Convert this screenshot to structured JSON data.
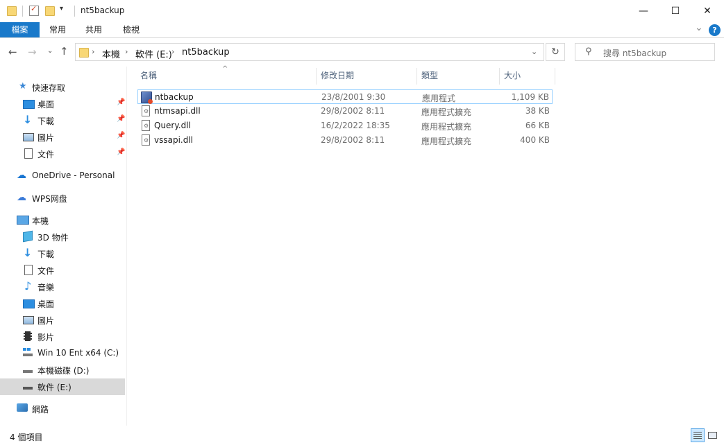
{
  "window": {
    "title": "nt5backup",
    "minimize_glyph": "—",
    "maximize_glyph": "☐",
    "close_glyph": "✕"
  },
  "ribbon": {
    "tabs": [
      "檔案",
      "常用",
      "共用",
      "檢視"
    ],
    "expand_glyph": "⌄",
    "help_glyph": "?"
  },
  "address": {
    "breadcrumb": [
      "本機",
      "軟件 (E:)",
      "nt5backup"
    ],
    "search_placeholder": "搜尋 nt5backup"
  },
  "sidebar": {
    "quick_access": {
      "label": "快速存取",
      "items": [
        {
          "label": "桌面",
          "icon": "desktop-icon"
        },
        {
          "label": "下載",
          "icon": "download-icon"
        },
        {
          "label": "圖片",
          "icon": "pictures-icon"
        },
        {
          "label": "文件",
          "icon": "documents-icon"
        }
      ]
    },
    "onedrive": "OneDrive - Personal",
    "wps": "WPS网盘",
    "this_pc": {
      "label": "本機",
      "items": [
        {
          "label": "3D 物件",
          "icon": "3d-objects-icon"
        },
        {
          "label": "下載",
          "icon": "download-icon"
        },
        {
          "label": "文件",
          "icon": "documents-icon"
        },
        {
          "label": "音樂",
          "icon": "music-icon"
        },
        {
          "label": "桌面",
          "icon": "desktop-icon"
        },
        {
          "label": "圖片",
          "icon": "pictures-icon"
        },
        {
          "label": "影片",
          "icon": "videos-icon"
        },
        {
          "label": "Win 10 Ent x64 (C:)",
          "icon": "windows-drive-icon"
        },
        {
          "label": "本機磁碟 (D:)",
          "icon": "drive-icon"
        },
        {
          "label": "軟件 (E:)",
          "icon": "drive-icon"
        }
      ]
    },
    "network": "網路"
  },
  "columns": {
    "name": "名稱",
    "date": "修改日期",
    "type": "類型",
    "size": "大小"
  },
  "files": [
    {
      "name": "ntbackup",
      "date": "23/8/2001 9:30",
      "type": "應用程式",
      "size": "1,109 KB",
      "icon": "app-icon"
    },
    {
      "name": "ntmsapi.dll",
      "date": "29/8/2002 8:11",
      "type": "應用程式擴充",
      "size": "38 KB",
      "icon": "dll-file-icon"
    },
    {
      "name": "Query.dll",
      "date": "16/2/2022 18:35",
      "type": "應用程式擴充",
      "size": "66 KB",
      "icon": "dll-file-icon"
    },
    {
      "name": "vssapi.dll",
      "date": "29/8/2002 8:11",
      "type": "應用程式擴充",
      "size": "400 KB",
      "icon": "dll-file-icon"
    }
  ],
  "status": {
    "item_count": "4 個項目"
  },
  "colors": {
    "accent": "#1979ca",
    "selection_bg": "#d9d9d9",
    "row_focus_border": "#99d1ff"
  }
}
